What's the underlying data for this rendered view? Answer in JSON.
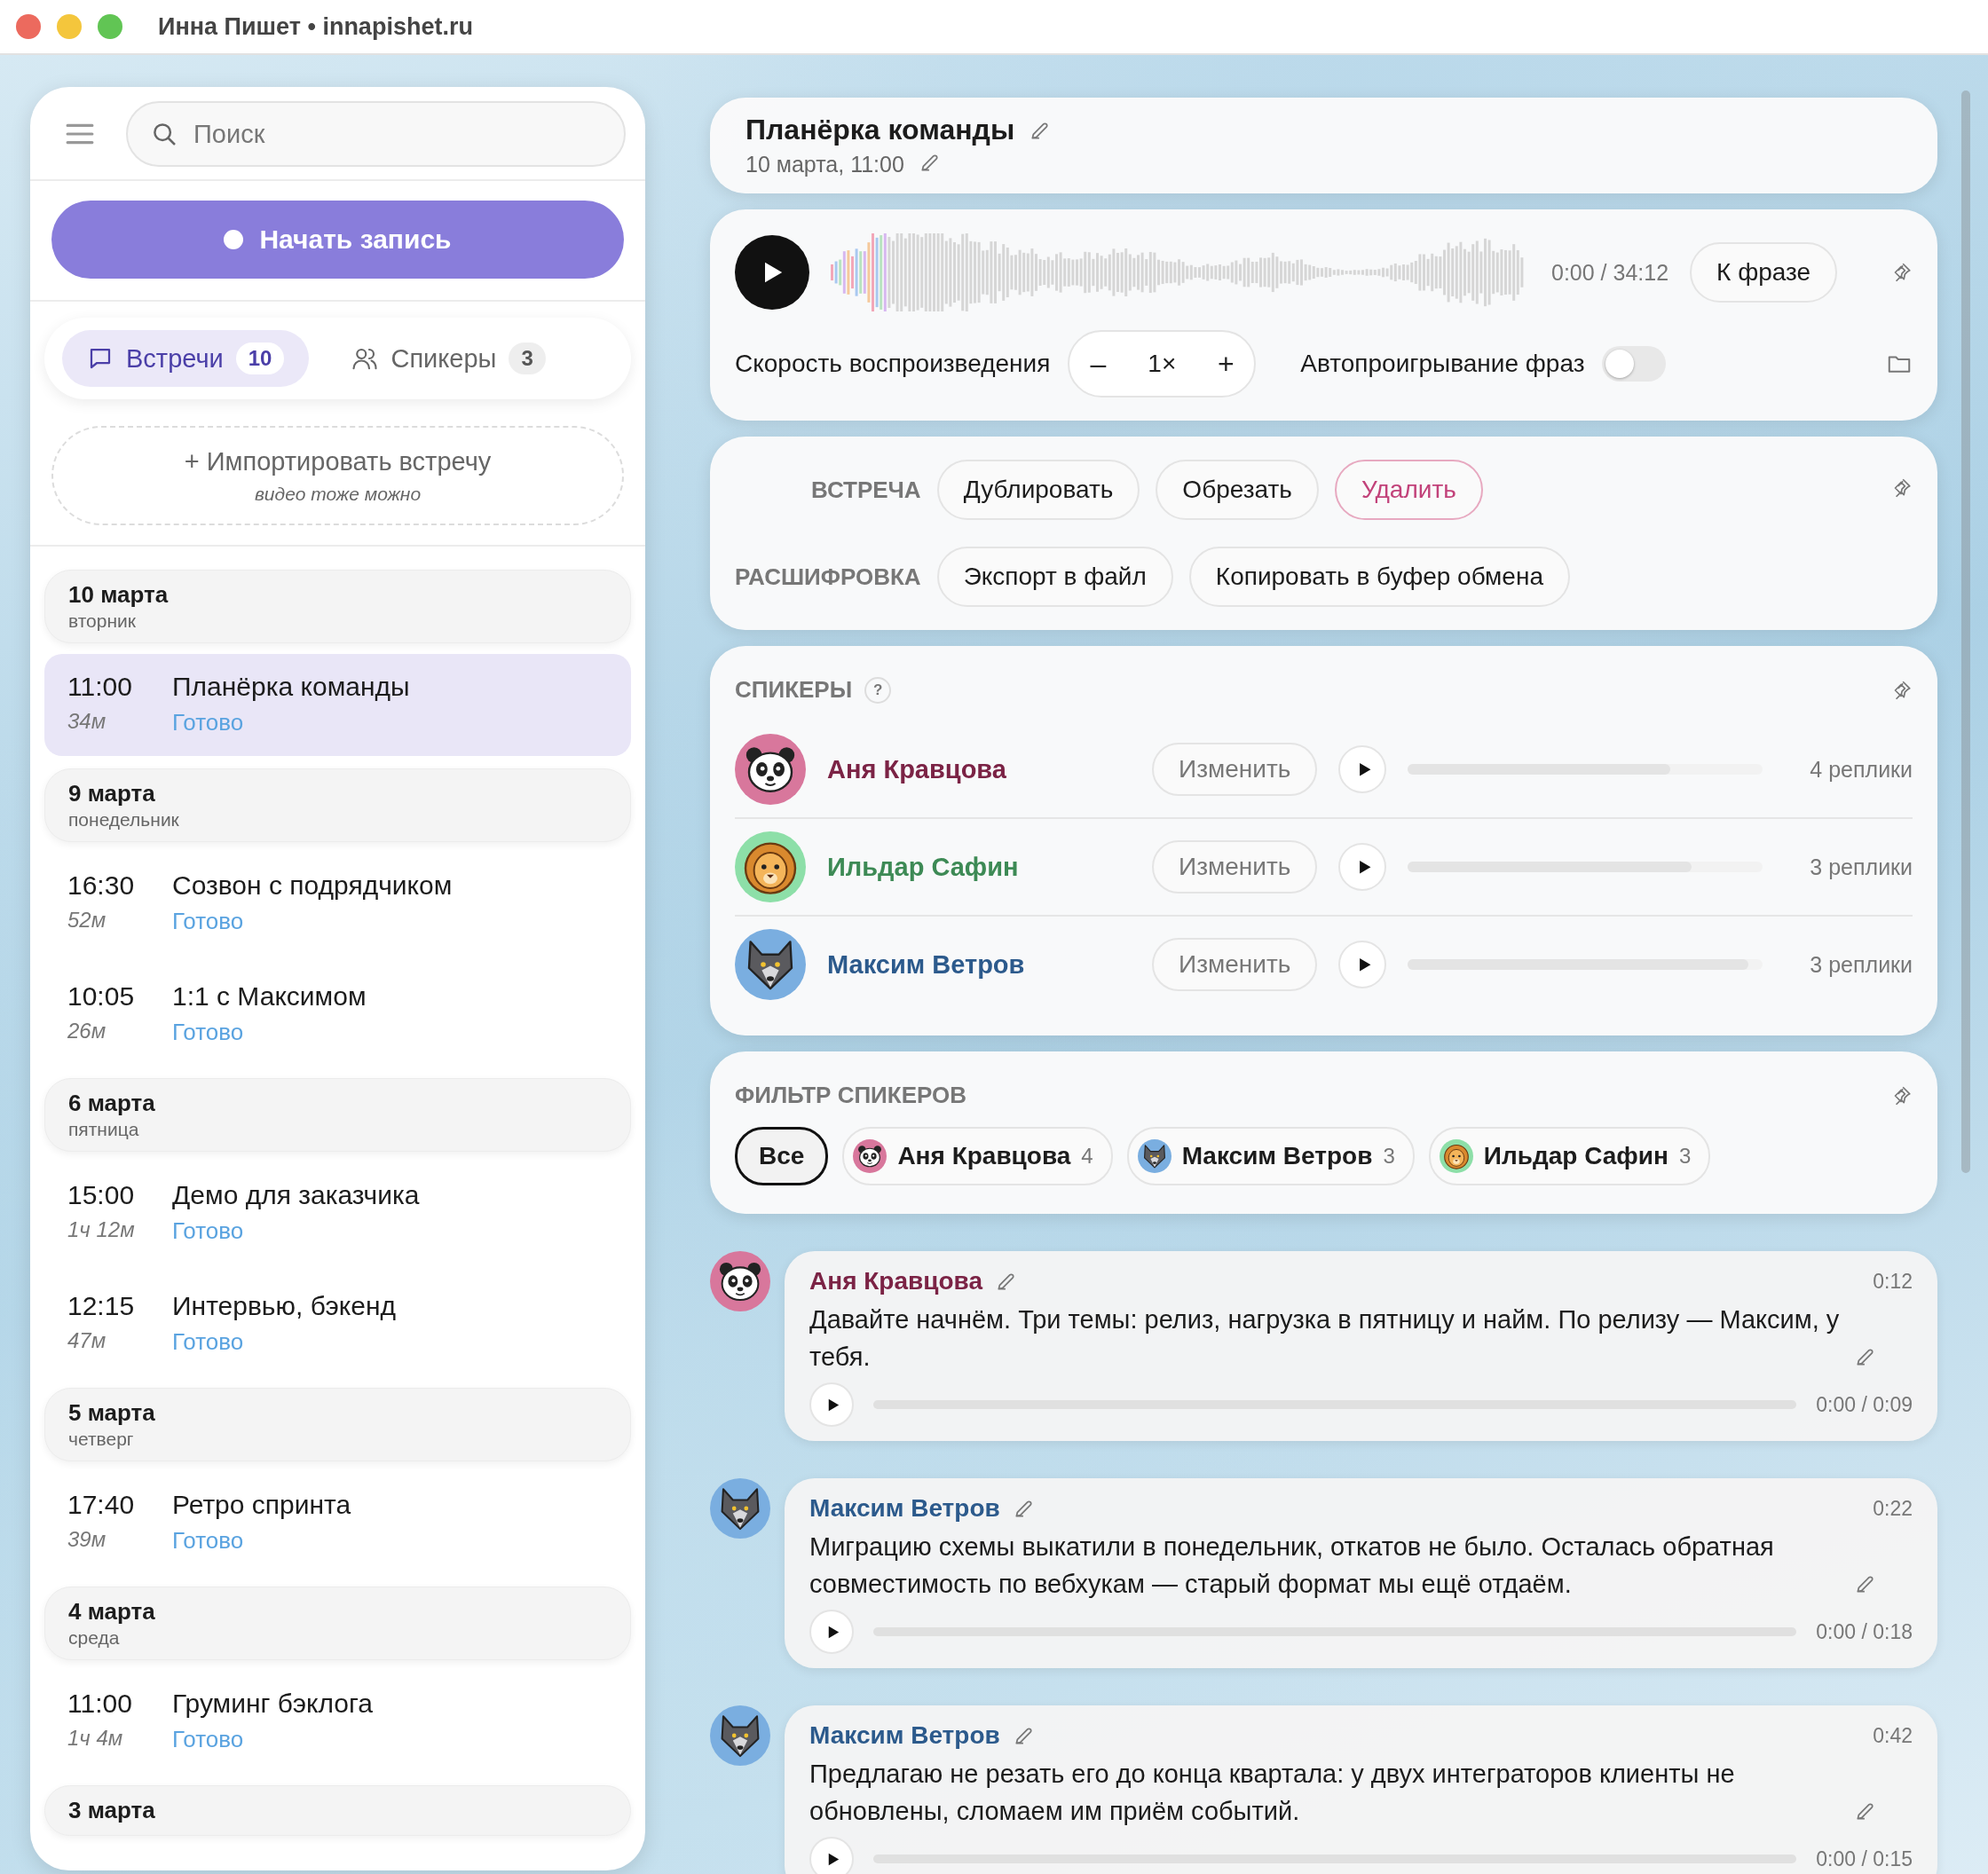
{
  "window": {
    "title": "Инна Пишет • innapishet.ru"
  },
  "sidebar": {
    "search": {
      "placeholder": "Поиск"
    },
    "record_button": "Начать запись",
    "tabs": [
      {
        "label": "Встречи",
        "count": "10",
        "selected": true,
        "kind": "chat"
      },
      {
        "label": "Спикеры",
        "count": "3",
        "selected": false,
        "kind": "people"
      }
    ],
    "import": {
      "label": "+ Импортировать встречу",
      "hint": "видео тоже можно"
    },
    "groups": [
      {
        "date": "10 марта",
        "weekday": "вторник",
        "meetings": [
          {
            "time": "11:00",
            "duration": "34м",
            "title": "Планёрка команды",
            "status": "Готово",
            "selected": true
          }
        ]
      },
      {
        "date": "9 марта",
        "weekday": "понедельник",
        "meetings": [
          {
            "time": "16:30",
            "duration": "52м",
            "title": "Созвон с подрядчиком",
            "status": "Готово",
            "selected": false
          },
          {
            "time": "10:05",
            "duration": "26м",
            "title": "1:1 с Максимом",
            "status": "Готово",
            "selected": false
          }
        ]
      },
      {
        "date": "6 марта",
        "weekday": "пятница",
        "meetings": [
          {
            "time": "15:00",
            "duration": "1ч 12м",
            "title": "Демо для заказчика",
            "status": "Готово",
            "selected": false
          },
          {
            "time": "12:15",
            "duration": "47м",
            "title": "Интервью, бэкенд",
            "status": "Готово",
            "selected": false
          }
        ]
      },
      {
        "date": "5 марта",
        "weekday": "четверг",
        "meetings": [
          {
            "time": "17:40",
            "duration": "39м",
            "title": "Ретро спринта",
            "status": "Готово",
            "selected": false
          }
        ]
      },
      {
        "date": "4 марта",
        "weekday": "среда",
        "meetings": [
          {
            "time": "11:00",
            "duration": "1ч 4м",
            "title": "Груминг бэклога",
            "status": "Готово",
            "selected": false
          }
        ]
      },
      {
        "date": "3 марта"
      }
    ]
  },
  "main": {
    "header": {
      "title": "Планёрка команды",
      "subtitle": "10 марта, 11:00"
    },
    "player": {
      "time": "0:00 / 34:12",
      "jump_button": "К фразе",
      "speed_label": "Скорость воспроизведения",
      "decrease": "–",
      "speed": "1×",
      "increase": "+",
      "autoplay_label": "Автопроигрывание фраз",
      "autoplay_on": false
    },
    "actions": [
      {
        "label": "ВСТРЕЧА",
        "buttons": [
          {
            "label": "Дублировать",
            "kind": "normal"
          },
          {
            "label": "Обрезать",
            "kind": "normal"
          },
          {
            "label": "Удалить",
            "kind": "danger"
          }
        ]
      },
      {
        "label": "РАСШИФРОВКА",
        "buttons": [
          {
            "label": "Экспорт в файл",
            "kind": "normal"
          },
          {
            "label": "Копировать в буфер обмена",
            "kind": "normal"
          }
        ]
      }
    ],
    "speakers": {
      "title": "СПИКЕРЫ",
      "help": "?",
      "items": [
        {
          "name": "Аня Кравцова",
          "kind": "panda",
          "color": "#7b2345",
          "edit_button": "Изменить",
          "level": 0.74,
          "count": "4 реплики"
        },
        {
          "name": "Ильдар Сафин",
          "kind": "lion",
          "color": "#3d8a55",
          "edit_button": "Изменить",
          "level": 0.8,
          "count": "3 реплики"
        },
        {
          "name": "Максим Ветров",
          "kind": "wolf",
          "color": "#2c5a8c",
          "edit_button": "Изменить",
          "level": 0.96,
          "count": "3 реплики"
        }
      ]
    },
    "filter": {
      "title": "ФИЛЬТР СПИКЕРОВ",
      "chips": [
        {
          "label": "Все",
          "kind": "plain",
          "selected": true
        },
        {
          "label": "Аня Кравцова",
          "count": "4",
          "kind": "panda",
          "selected": false
        },
        {
          "label": "Максим Ветров",
          "count": "3",
          "kind": "wolf",
          "selected": false
        },
        {
          "label": "Ильдар Сафин",
          "count": "3",
          "kind": "lion",
          "selected": false
        }
      ]
    },
    "messages": [
      {
        "name": "Аня Кравцова",
        "kind": "panda",
        "color": "#7b2345",
        "time": "0:12",
        "text": "Давайте начнём. Три темы: релиз, нагрузка в пятницу и найм. По релизу — Максим, у тебя.",
        "position": "0:00 / 0:09"
      },
      {
        "name": "Максим Ветров",
        "kind": "wolf",
        "color": "#2c5a8c",
        "time": "0:22",
        "text": "Миграцию схемы выкатили в понедельник, откатов не было. Осталась обратная совместимость по вебхукам — старый формат мы ещё отдаём.",
        "position": "0:00 / 0:18"
      },
      {
        "name": "Максим Ветров",
        "kind": "wolf",
        "color": "#2c5a8c",
        "time": "0:42",
        "text": "Предлагаю не резать его до конца квартала: у двух интеграторов клиенты не обновлены, сломаем им приём событий.",
        "position": "0:00 / 0:15"
      }
    ]
  }
}
